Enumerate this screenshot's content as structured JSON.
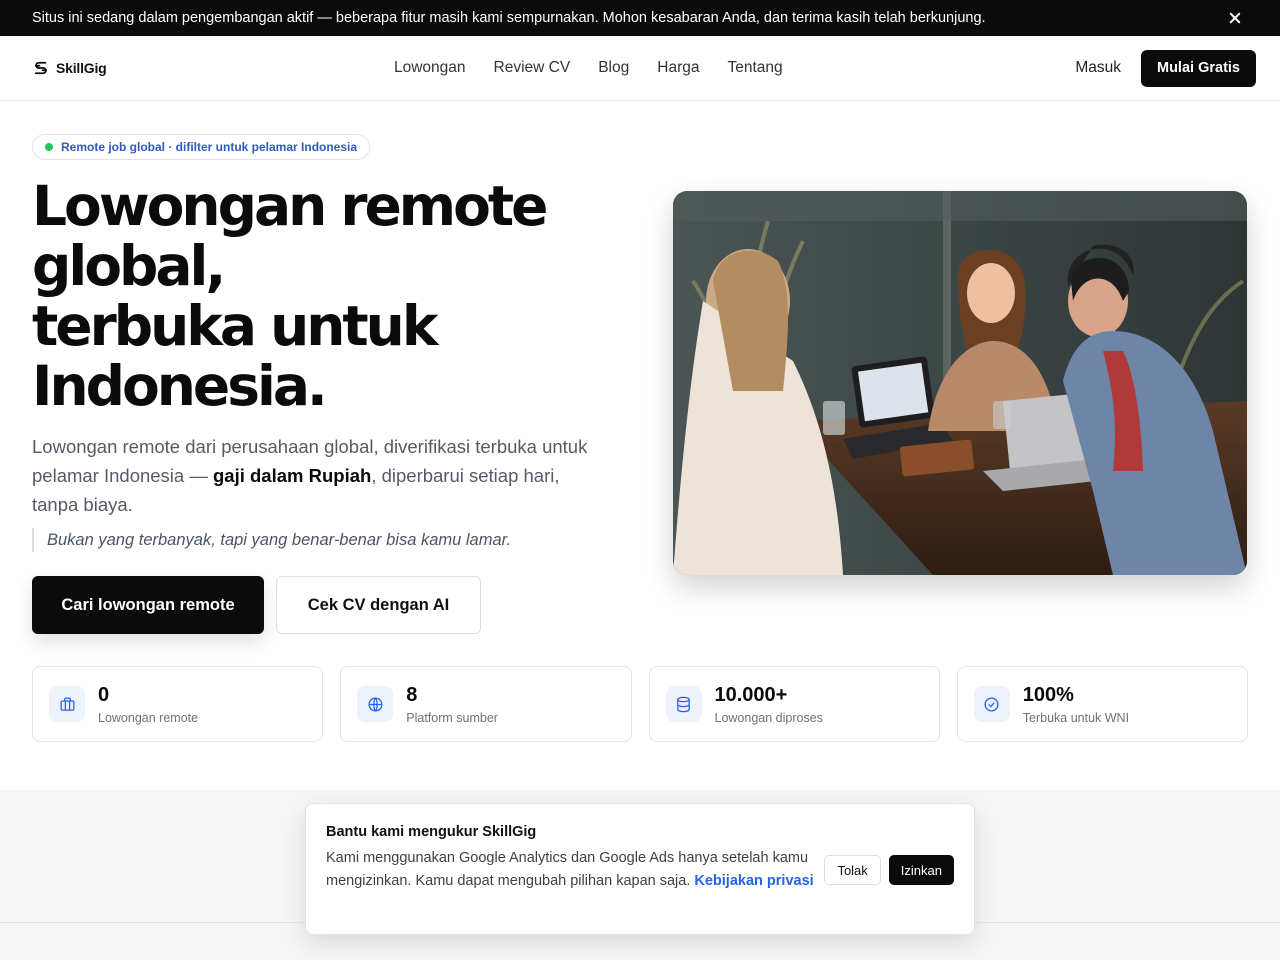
{
  "announcement": {
    "text": "Situs ini sedang dalam pengembangan aktif — beberapa fitur masih kami sempurnakan. Mohon kesabaran Anda, dan terima kasih telah berkunjung.",
    "close_icon": "close-icon"
  },
  "header": {
    "logo_text": "SkillGig",
    "logo_icon": "skillgig-logo-icon",
    "nav": [
      "Lowongan",
      "Review CV",
      "Blog",
      "Harga",
      "Tentang"
    ],
    "login_label": "Masuk",
    "cta_label": "Mulai Gratis"
  },
  "hero": {
    "badge": "Remote job global · difilter untuk pelamar Indonesia",
    "title_lines": [
      "Lowongan remote",
      "global,",
      "terbuka untuk",
      "Indonesia."
    ],
    "desc_before": "Lowongan remote dari perusahaan global, diverifikasi terbuka untuk pelamar Indonesia — ",
    "desc_bold": "gaji dalam Rupiah",
    "desc_after": ", diperbarui setiap hari, tanpa biaya.",
    "quote": "Bukan yang terbanyak, tapi yang benar-benar bisa kamu lamar.",
    "primary_button": "Cari lowongan remote",
    "secondary_button": "Cek CV dengan AI",
    "image_alt": "Tiga orang tersenyum bekerja dengan laptop di meja kafe"
  },
  "stats": [
    {
      "value": "0",
      "label": "Lowongan remote",
      "icon": "briefcase-icon"
    },
    {
      "value": "8",
      "label": "Platform sumber",
      "icon": "globe-icon"
    },
    {
      "value": "10.000+",
      "label": "Lowongan diproses",
      "icon": "database-icon"
    },
    {
      "value": "100%",
      "label": "Terbuka untuk WNI",
      "icon": "check-circle-icon"
    }
  ],
  "cookie": {
    "title": "Bantu kami mengukur SkillGig",
    "text": "Kami menggunakan Google Analytics dan Google Ads hanya setelah kamu mengizinkan. Kamu dapat mengubah pilihan kapan saja. ",
    "link": "Kebijakan privasi",
    "decline": "Tolak",
    "allow": "Izinkan"
  },
  "colors": {
    "dark": "#0b0b0b",
    "accent_blue": "#2563eb",
    "badge_dot": "#22c55e",
    "icon_bg": "#eef2fb"
  }
}
